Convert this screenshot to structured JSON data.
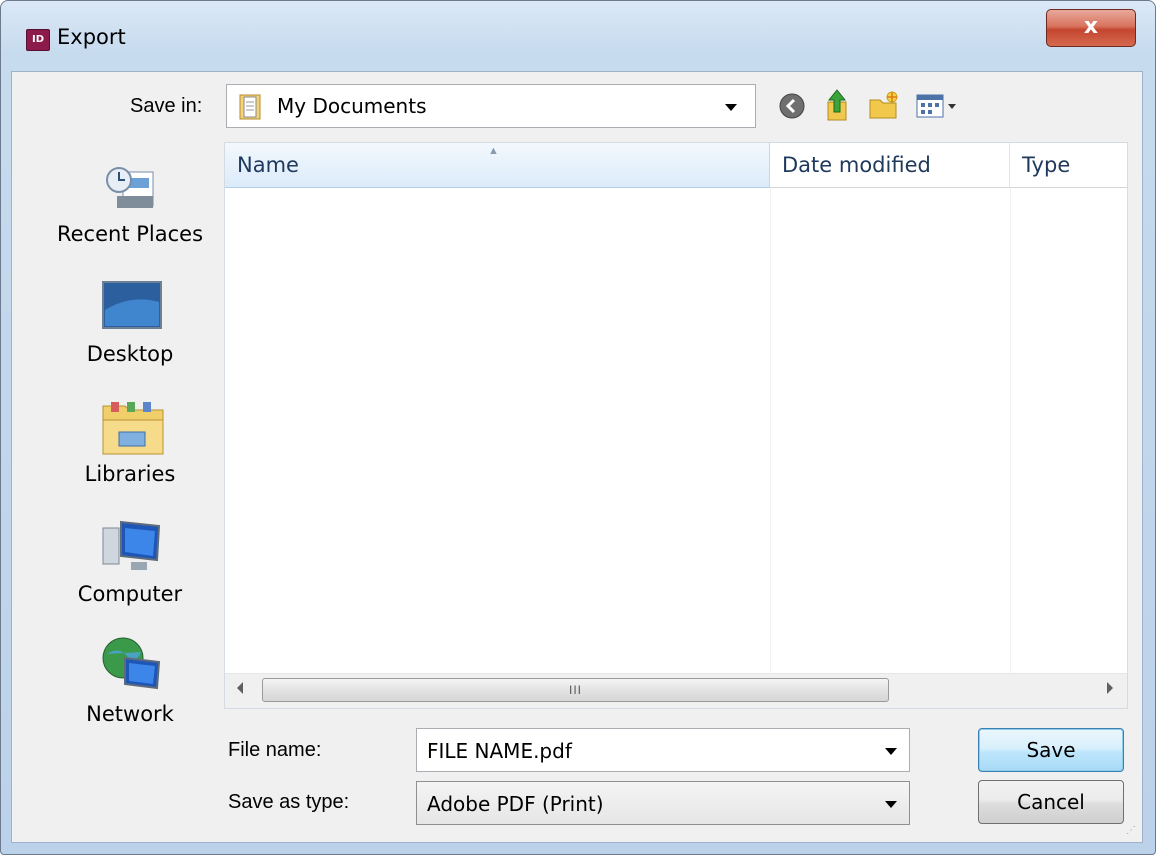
{
  "window": {
    "title": "Export",
    "app_icon_text": "ID",
    "close_label": "x"
  },
  "toolbar": {
    "save_in_label": "Save in:",
    "location": "My Documents",
    "icons": [
      "back-icon",
      "up-folder-icon",
      "new-folder-icon",
      "view-menu-icon"
    ]
  },
  "places": [
    {
      "label": "Recent Places",
      "icon": "recent-places-icon"
    },
    {
      "label": "Desktop",
      "icon": "desktop-icon"
    },
    {
      "label": "Libraries",
      "icon": "libraries-icon"
    },
    {
      "label": "Computer",
      "icon": "computer-icon"
    },
    {
      "label": "Network",
      "icon": "network-icon"
    }
  ],
  "file_list": {
    "columns": [
      "Name",
      "Date modified",
      "Type"
    ],
    "rows": [],
    "scrollbar_grip": "III"
  },
  "form": {
    "file_name_label": "File name:",
    "file_name_value": "FILE NAME.pdf",
    "save_as_type_label": "Save as type:",
    "save_as_type_value": "Adobe PDF (Print)"
  },
  "buttons": {
    "save": "Save",
    "cancel": "Cancel"
  }
}
